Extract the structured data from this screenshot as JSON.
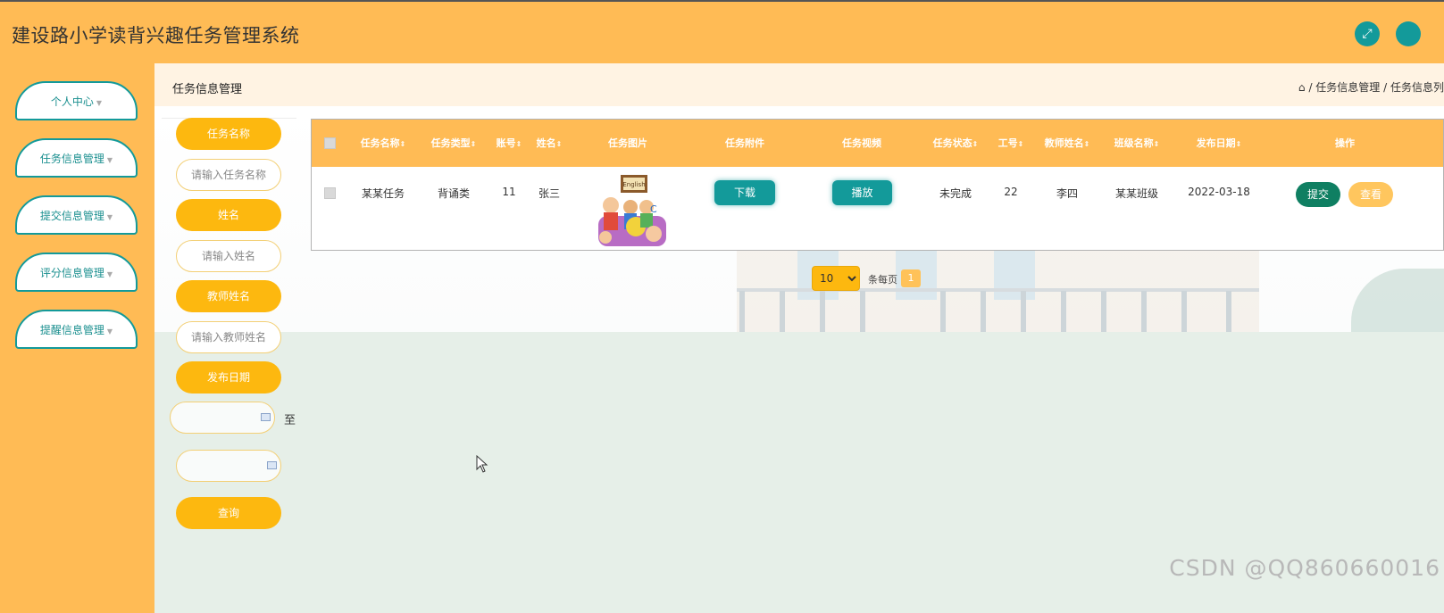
{
  "app": {
    "title": "建设路小学读背兴趣任务管理系统",
    "accent": "#ffbb55",
    "teal": "#139a9a",
    "yellow": "#fdb80f"
  },
  "header": {
    "fullscreen_icon": "expand-icon",
    "profile_icon": "user-icon"
  },
  "sidebar": {
    "items": [
      {
        "label": "个人中心"
      },
      {
        "label": "任务信息管理"
      },
      {
        "label": "提交信息管理"
      },
      {
        "label": "评分信息管理"
      },
      {
        "label": "提醒信息管理"
      }
    ]
  },
  "page": {
    "heading": "任务信息管理",
    "breadcrumb": [
      "任务信息管理",
      "任务信息列"
    ]
  },
  "filters": {
    "task_name_label": "任务名称",
    "task_name_placeholder": "请输入任务名称",
    "name_label": "姓名",
    "name_placeholder": "请输入姓名",
    "teacher_label": "教师姓名",
    "teacher_placeholder": "请输入教师姓名",
    "date_label": "发布日期",
    "date_to": "至",
    "query_label": "查询"
  },
  "table": {
    "columns": [
      "任务名称",
      "任务类型",
      "账号",
      "姓名",
      "任务图片",
      "任务附件",
      "任务视频",
      "任务状态",
      "工号",
      "教师姓名",
      "班级名称",
      "发布日期",
      "操作"
    ],
    "rows": [
      {
        "task_name": "某某任务",
        "task_type": "背诵类",
        "account": "11",
        "name": "张三",
        "image_alt": "English",
        "attachment_btn": "下载",
        "video_btn": "播放",
        "status": "未完成",
        "teacher_id": "22",
        "teacher_name": "李四",
        "class_name": "某某班级",
        "publish_date": "2022-03-18",
        "submit_btn": "提交",
        "view_btn": "查看"
      }
    ]
  },
  "pagination": {
    "page_size": "10",
    "per_page_text": "条每页",
    "current_page": "1"
  },
  "watermark": "CSDN @QQ860660016"
}
